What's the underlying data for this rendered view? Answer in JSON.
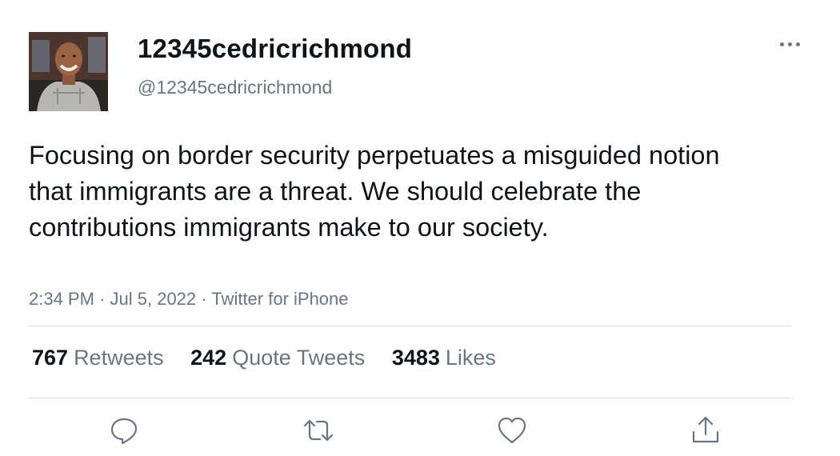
{
  "author": {
    "name": "12345cedricrichmond",
    "handle": "@12345cedricrichmond",
    "avatar_icon": "profile-photo"
  },
  "tweet": {
    "text": "Focusing on border security perpetuates a misguided notion that immigrants are a threat. We should celebrate the contributions immigrants make to our society.",
    "time": "2:34 PM",
    "date": "Jul 5, 2022",
    "source": "Twitter for iPhone",
    "separator": "·"
  },
  "stats": {
    "retweets_count": "767",
    "retweets_label": "Retweets",
    "quotes_count": "242",
    "quotes_label": "Quote Tweets",
    "likes_count": "3483",
    "likes_label": "Likes"
  },
  "actions": [
    "reply-icon",
    "retweet-icon",
    "like-icon",
    "share-icon"
  ],
  "colors": {
    "text": "#0f1419",
    "secondary": "#687684",
    "divider": "#d9dde1",
    "background": "#ffffff"
  }
}
